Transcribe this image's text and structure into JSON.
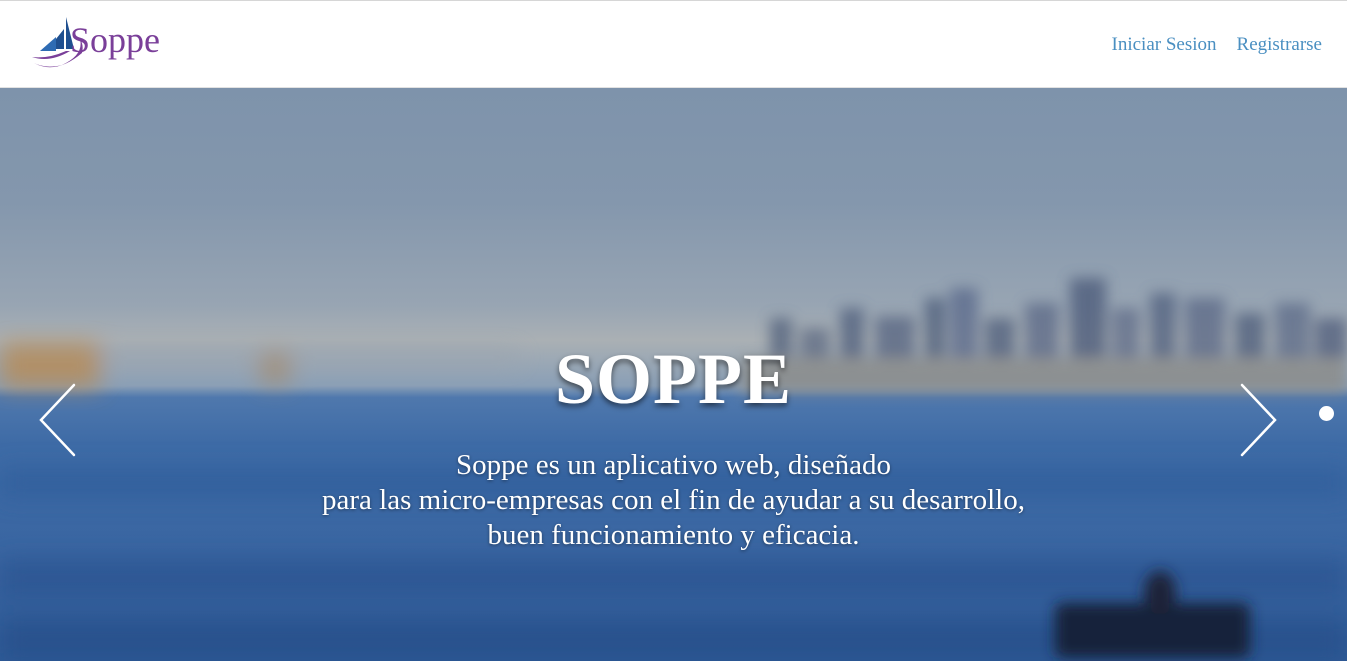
{
  "header": {
    "brand_name": "Soppe",
    "nav": {
      "login": "Iniciar Sesion",
      "register": "Registrarse"
    }
  },
  "hero": {
    "title": "SOPPE",
    "description": [
      "Soppe es un aplicativo web, diseñado",
      "para las micro-empresas con el fin de ayudar a su desarrollo,",
      "buen funcionamiento y eficacia."
    ],
    "prev_icon": "chevron-left-icon",
    "next_icon": "chevron-right-icon",
    "indicator_count": 1,
    "active_indicator": 1
  },
  "colors": {
    "brand": "#7a3f99",
    "logo_blue": "#1f4f8f",
    "nav_link": "#4a8fc1",
    "hero_text": "#ffffff"
  }
}
